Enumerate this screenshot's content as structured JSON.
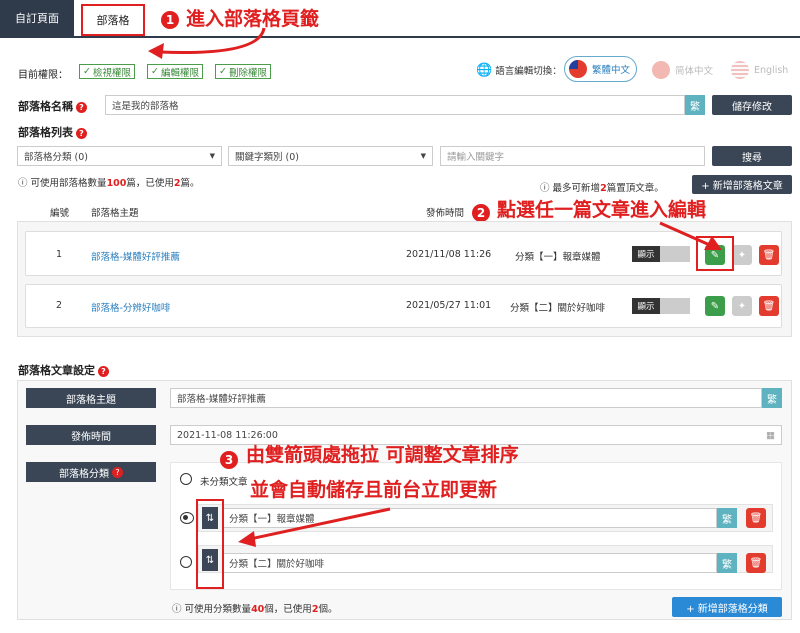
{
  "tabs": [
    {
      "label": "自訂頁面"
    },
    {
      "label": "部落格"
    }
  ],
  "annotations": {
    "step1": {
      "num": "1",
      "text": "進入部落格頁籤"
    },
    "step2": {
      "num": "2",
      "text": "點選任一篇文章進入編輯"
    },
    "step3": {
      "num": "3",
      "line1": "由雙箭頭處拖拉 可調整文章排序",
      "line2": "並會自動儲存且前台立即更新"
    }
  },
  "permissions": {
    "label": "目前權限：",
    "items": [
      "檢視權限",
      "編輯權限",
      "刪除權限"
    ]
  },
  "language": {
    "label": "語言編輯切換：",
    "options": [
      "繁體中文",
      "简体中文",
      "English"
    ]
  },
  "blog_name": {
    "label": "部落格名稱",
    "value": "這是我的部落格",
    "convert": "繁",
    "save_label": "儲存修改"
  },
  "blog_list": {
    "label": "部落格列表",
    "category_filter": "部落格分類 (0)",
    "keyword_filter": "關鍵字類別 (0)",
    "keyword_placeholder": "請輸入關鍵字",
    "search_label": "搜尋",
    "quota_pre": "可使用部落格數量",
    "quota_total": "100",
    "quota_mid": "篇，已使用",
    "quota_used": "2",
    "quota_post": "篇。",
    "pin_pre": "最多可新增",
    "pin_count": "2",
    "pin_post": "篇置頂文章。",
    "add_label": "+ 新增部落格文章",
    "headers": {
      "num": "編號",
      "title": "部落格主題",
      "date": "發佈時間"
    },
    "rows": [
      {
        "num": "1",
        "title": "部落格-媒體好評推薦",
        "date": "2021/11/08 11:26",
        "category": "分類【一】報章媒體",
        "status": "顯示"
      },
      {
        "num": "2",
        "title": "部落格-分辨好咖啡",
        "date": "2021/05/27 11:01",
        "category": "分類【二】關於好咖啡",
        "status": "顯示"
      }
    ]
  },
  "settings": {
    "title": "部落格文章設定",
    "subject_label": "部落格主題",
    "subject_value": "部落格-媒體好評推薦",
    "convert": "繁",
    "date_label": "發佈時間",
    "date_value": "2021-11-08 11:26:00",
    "category_label": "部落格分類",
    "uncategorized": "未分類文章",
    "categories": [
      "分類【一】報章媒體",
      "分類【二】關於好咖啡"
    ],
    "quota_pre": "可使用分類數量",
    "quota_total": "40",
    "quota_mid": "個，已使用",
    "quota_used": "2",
    "quota_post": "個。",
    "add_label": "+ 新增部落格分類"
  }
}
